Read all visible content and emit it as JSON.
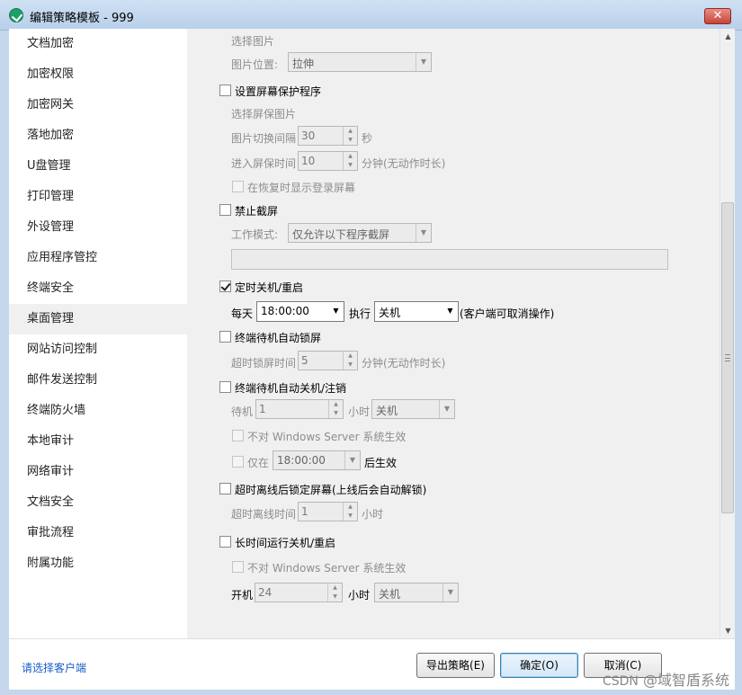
{
  "window": {
    "title": "编辑策略模板 - 999",
    "close_glyph": "✕"
  },
  "sidebar": {
    "items": [
      "文档加密",
      "加密权限",
      "加密网关",
      "落地加密",
      "U盘管理",
      "打印管理",
      "外设管理",
      "应用程序管控",
      "终端安全",
      "桌面管理",
      "网站访问控制",
      "邮件发送控制",
      "终端防火墙",
      "本地审计",
      "网络审计",
      "文档安全",
      "审批流程",
      "附属功能"
    ],
    "active": "桌面管理"
  },
  "content": {
    "select_image_label": "选择图片",
    "image_position_label": "图片位置:",
    "image_position_value": "拉伸",
    "screensaver": {
      "label": "设置屏幕保护程序",
      "checked": false,
      "select_image_label": "选择屏保图片",
      "switch_interval_label": "图片切换间隔",
      "switch_interval_value": "30",
      "switch_interval_unit": "秒",
      "enter_time_label": "进入屏保时间",
      "enter_time_value": "10",
      "enter_time_unit": "分钟(无动作时长)",
      "show_login_label": "在恢复时显示登录屏幕"
    },
    "no_screenshot": {
      "label": "禁止截屏",
      "checked": false,
      "mode_label": "工作模式:",
      "mode_value": "仅允许以下程序截屏"
    },
    "scheduled_shutdown": {
      "label": "定时关机/重启",
      "checked": true,
      "daily_label": "每天",
      "time_value": "18:00:00",
      "execute_label": "执行",
      "action_value": "关机",
      "note": "(客户端可取消操作)"
    },
    "idle_lock": {
      "label": "终端待机自动锁屏",
      "checked": false,
      "timeout_label": "超时锁屏时间",
      "timeout_value": "5",
      "timeout_unit": "分钟(无动作时长)"
    },
    "idle_shutdown": {
      "label": "终端待机自动关机/注销",
      "checked": false,
      "standby_label": "待机",
      "standby_value": "1",
      "hours_label": "小时",
      "action_value": "关机",
      "not_windows_server_label": "不对 Windows Server 系统生效",
      "only_at_label": "仅在",
      "only_at_value": "18:00:00",
      "after_effect_label": "后生效"
    },
    "offline_lock": {
      "label": "超时离线后锁定屏幕(上线后会自动解锁)",
      "checked": false,
      "timeout_label": "超时离线时间",
      "timeout_value": "1",
      "hours_label": "小时"
    },
    "long_run": {
      "label": "长时间运行关机/重启",
      "checked": false,
      "not_windows_server_label": "不对 Windows Server 系统生效",
      "boot_label": "开机",
      "boot_value": "24",
      "hours_label": "小时",
      "action_value": "关机"
    }
  },
  "footer": {
    "select_client_link": "请选择客户端",
    "export_button": "导出策略(E)",
    "ok_button": "确定(O)",
    "cancel_button": "取消(C)"
  },
  "watermark": {
    "prefix": "CSDN",
    "suffix": "@域智盾系统"
  },
  "colors": {
    "link": "#1a5cc8",
    "title_bar": "#c5d7ec",
    "close_button": "#c7443a"
  }
}
